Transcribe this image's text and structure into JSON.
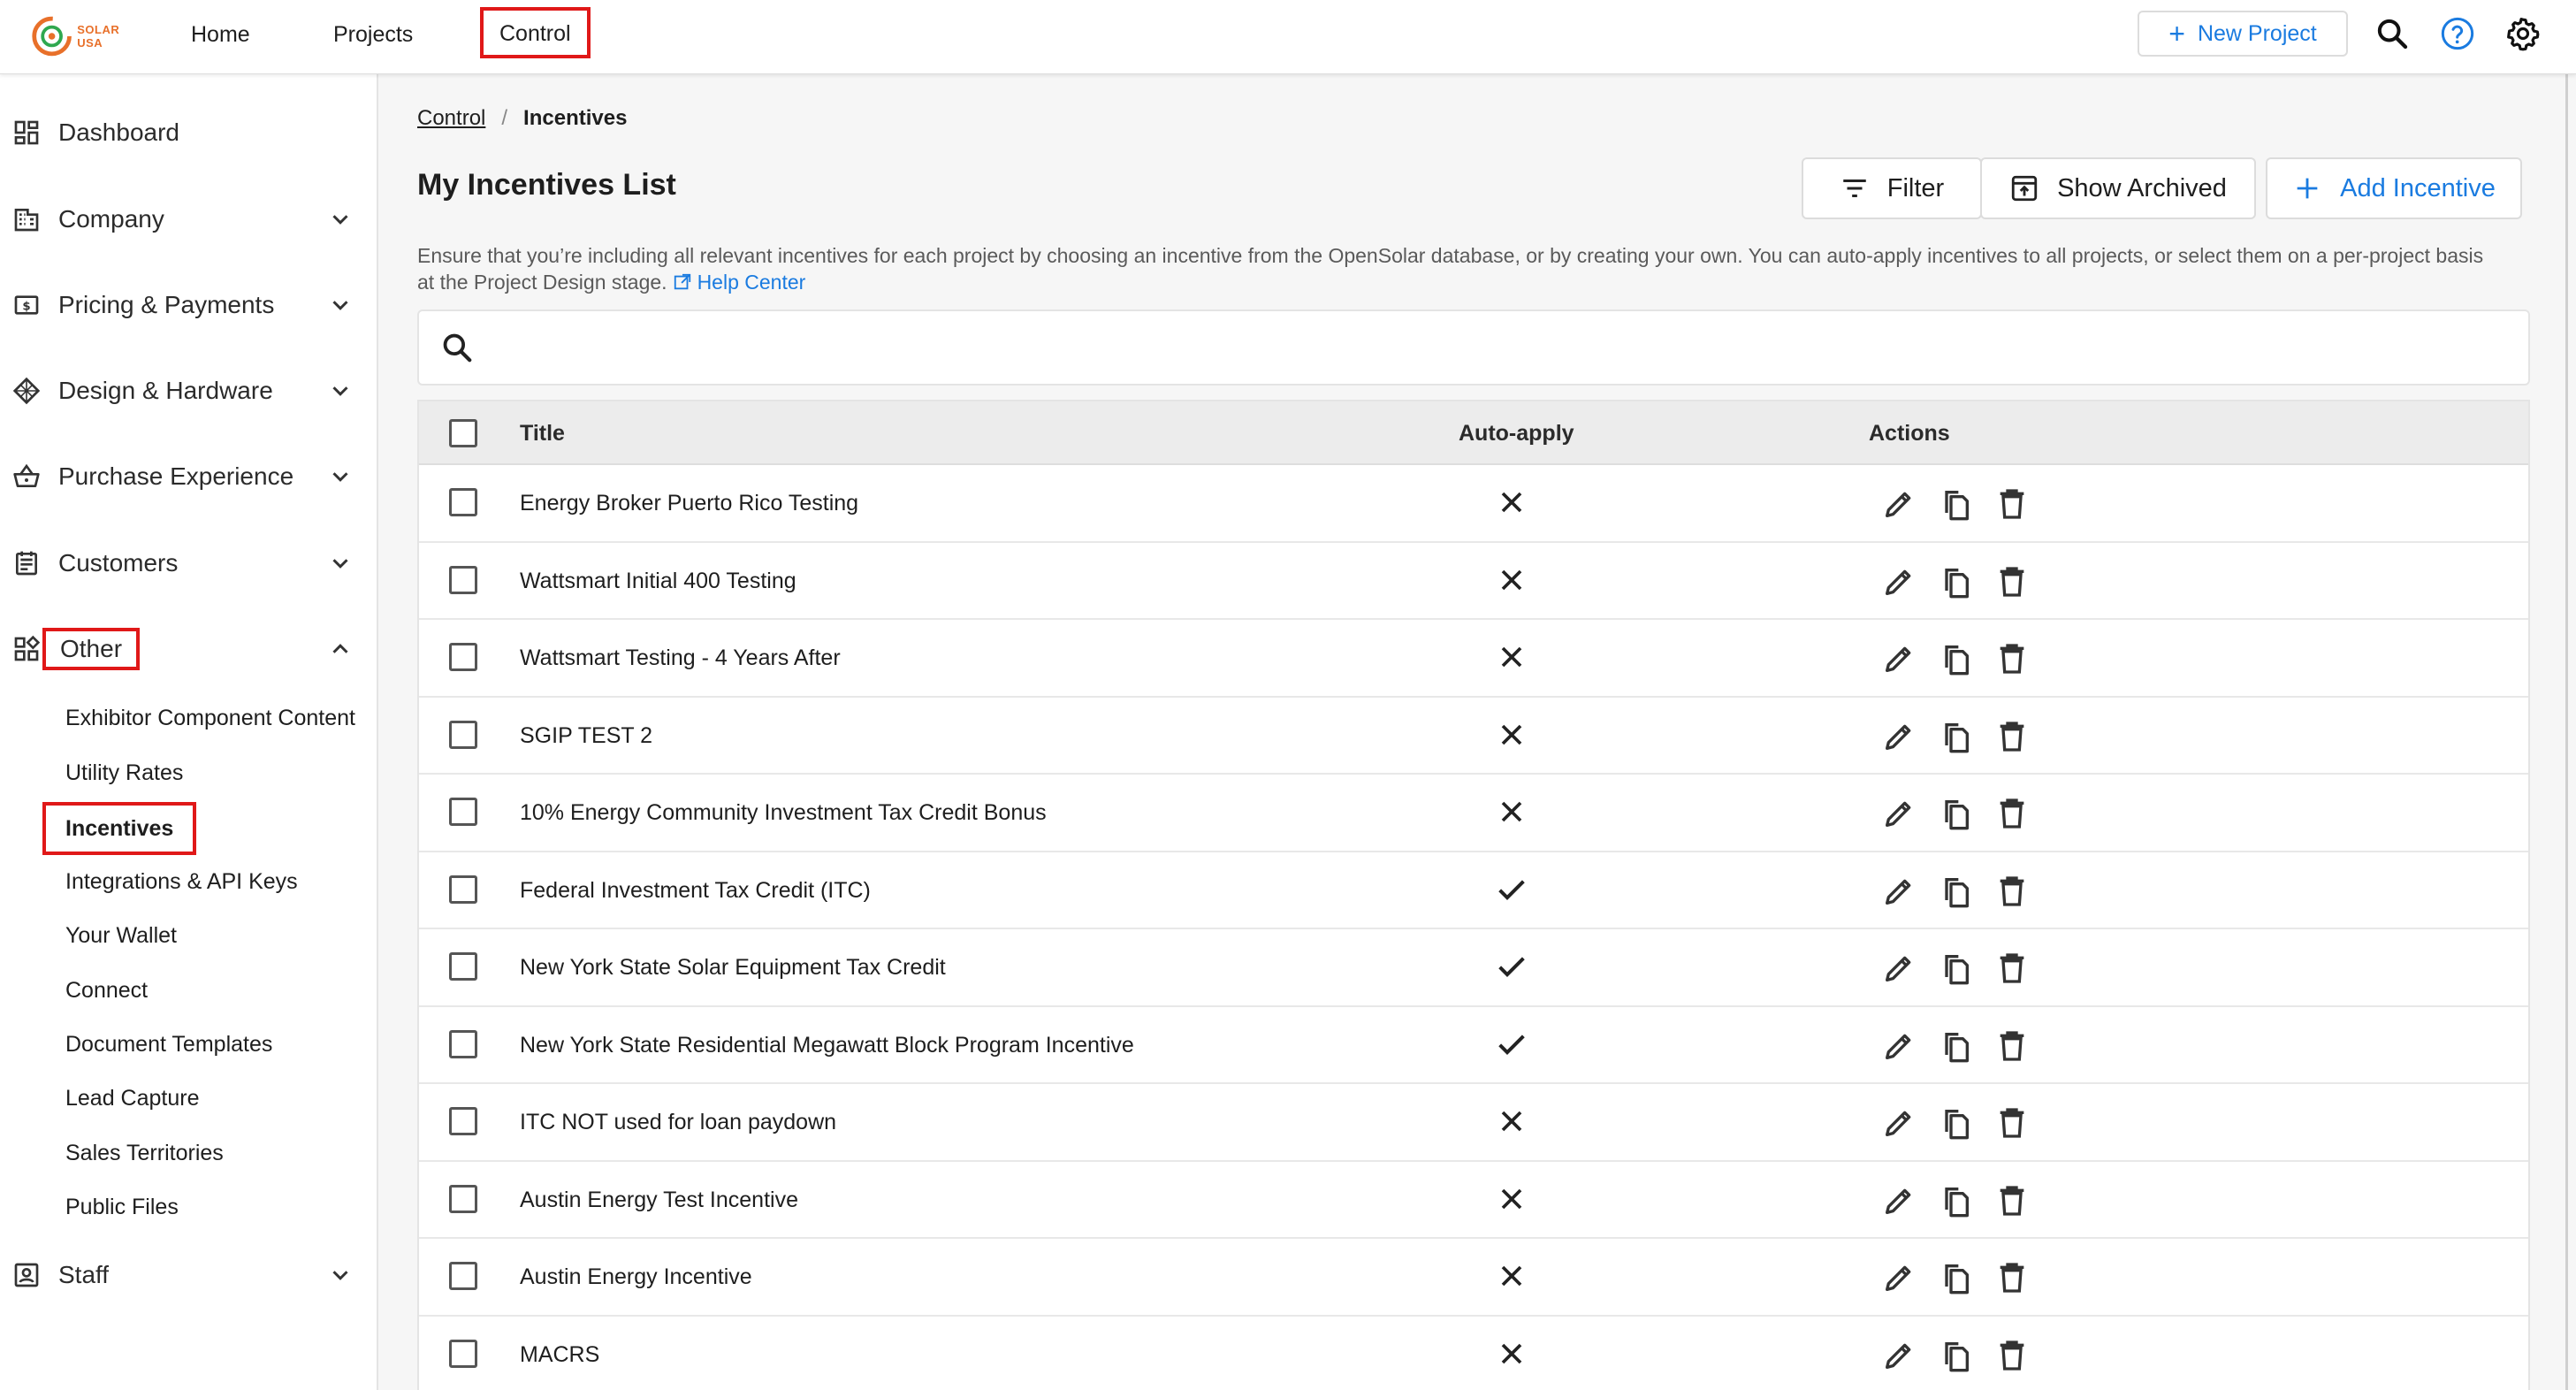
{
  "topbar": {
    "logo_text": "SOLAR USA",
    "nav": [
      {
        "label": "Home"
      },
      {
        "label": "Projects"
      },
      {
        "label": "Control"
      }
    ],
    "new_project_label": "New Project"
  },
  "sidebar": {
    "items": [
      {
        "label": "Dashboard",
        "icon": "dashboard-icon",
        "expandable": false
      },
      {
        "label": "Company",
        "icon": "building-icon",
        "expandable": true
      },
      {
        "label": "Pricing & Payments",
        "icon": "money-icon",
        "expandable": true
      },
      {
        "label": "Design & Hardware",
        "icon": "grid-diamond-icon",
        "expandable": true
      },
      {
        "label": "Purchase Experience",
        "icon": "basket-icon",
        "expandable": true
      },
      {
        "label": "Customers",
        "icon": "contacts-icon",
        "expandable": true
      },
      {
        "label": "Other",
        "icon": "widgets-icon",
        "expandable": true,
        "expanded": true
      },
      {
        "label": "Staff",
        "icon": "badge-icon",
        "expandable": true
      }
    ],
    "other_sub_items": [
      {
        "label": "Exhibitor Component Content"
      },
      {
        "label": "Utility Rates"
      },
      {
        "label": "Incentives",
        "active": true
      },
      {
        "label": "Integrations & API Keys"
      },
      {
        "label": "Your Wallet"
      },
      {
        "label": "Connect"
      },
      {
        "label": "Document Templates"
      },
      {
        "label": "Lead Capture"
      },
      {
        "label": "Sales Territories"
      },
      {
        "label": "Public Files"
      }
    ]
  },
  "breadcrumb": {
    "parent": "Control",
    "separator": "/",
    "current": "Incentives"
  },
  "page": {
    "title": "My Incentives List",
    "filter_label": "Filter",
    "show_archived_label": "Show Archived",
    "add_incentive_label": "Add Incentive",
    "description": "Ensure that you’re including all relevant incentives for each project by choosing an incentive from the OpenSolar database, or by creating your own. You can auto-apply incentives to all projects, or select them on a per-project basis at the Project Design stage.",
    "help_link": "Help Center"
  },
  "table": {
    "columns": {
      "title": "Title",
      "auto_apply": "Auto-apply",
      "actions": "Actions"
    },
    "rows": [
      {
        "title": "Energy Broker Puerto Rico Testing",
        "auto_apply": false
      },
      {
        "title": "Wattsmart Initial 400 Testing",
        "auto_apply": false
      },
      {
        "title": "Wattsmart Testing - 4 Years After",
        "auto_apply": false
      },
      {
        "title": "SGIP TEST 2",
        "auto_apply": false
      },
      {
        "title": "10% Energy Community Investment Tax Credit Bonus",
        "auto_apply": false
      },
      {
        "title": "Federal Investment Tax Credit (ITC)",
        "auto_apply": true
      },
      {
        "title": "New York State Solar Equipment Tax Credit",
        "auto_apply": true
      },
      {
        "title": "New York State Residential Megawatt Block Program Incentive",
        "auto_apply": true
      },
      {
        "title": "ITC NOT used for loan paydown",
        "auto_apply": false
      },
      {
        "title": "Austin Energy Test Incentive",
        "auto_apply": false
      },
      {
        "title": "Austin Energy Incentive",
        "auto_apply": false
      },
      {
        "title": "MACRS",
        "auto_apply": false
      }
    ]
  },
  "colors": {
    "accent": "#1a7be0",
    "highlight": "#e01818",
    "logo_orange": "#e8702a"
  }
}
